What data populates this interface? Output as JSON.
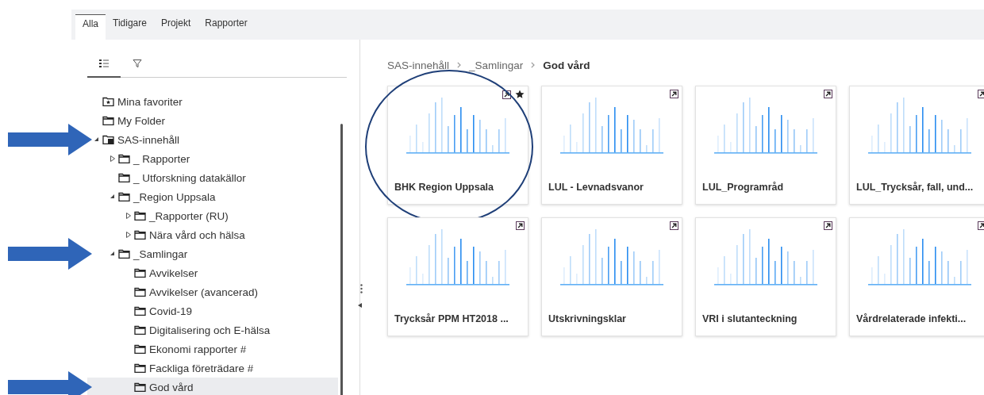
{
  "tabs": [
    {
      "label": "Alla",
      "selected": true
    },
    {
      "label": "Tidigare",
      "selected": false
    },
    {
      "label": "Projekt",
      "selected": false
    },
    {
      "label": "Rapporter",
      "selected": false
    }
  ],
  "view_tabs": [
    {
      "kind": "list",
      "selected": true
    },
    {
      "kind": "filter",
      "selected": false
    }
  ],
  "tree": [
    {
      "label": "Mina favoriter",
      "kind": "favorites",
      "selected": false,
      "arrow": false
    },
    {
      "label": "My Folder",
      "kind": "folder",
      "selected": false,
      "arrow": false
    },
    {
      "label": "SAS-innehåll",
      "kind": "root",
      "selected": false,
      "arrow": true,
      "expanded": true,
      "children": [
        {
          "label": "_ Rapporter",
          "kind": "folder",
          "selected": false,
          "arrow": false,
          "expanded": false
        },
        {
          "label": "_ Utforskning datakällor",
          "kind": "folder",
          "selected": false,
          "arrow": false
        },
        {
          "label": "_Region Uppsala",
          "kind": "folder",
          "selected": false,
          "arrow": false,
          "expanded": true,
          "children": [
            {
              "label": "_Rapporter (RU)",
              "kind": "folder",
              "selected": false,
              "arrow": false,
              "expanded": false
            },
            {
              "label": "Nära vård och hälsa",
              "kind": "folder",
              "selected": false,
              "arrow": false,
              "expanded": false
            }
          ]
        },
        {
          "label": "_Samlingar",
          "kind": "folder",
          "selected": false,
          "arrow": true,
          "expanded": true,
          "children": [
            {
              "label": "Avvikelser",
              "kind": "folder",
              "selected": false,
              "arrow": false
            },
            {
              "label": "Avvikelser (avancerad)",
              "kind": "folder",
              "selected": false,
              "arrow": false
            },
            {
              "label": "Covid-19",
              "kind": "folder",
              "selected": false,
              "arrow": false
            },
            {
              "label": "Digitalisering och E-hälsa",
              "kind": "folder",
              "selected": false,
              "arrow": false
            },
            {
              "label": "Ekonomi rapporter #",
              "kind": "folder",
              "selected": false,
              "arrow": false
            },
            {
              "label": "Fackliga företrädare #",
              "kind": "folder",
              "selected": false,
              "arrow": false
            },
            {
              "label": "God vård",
              "kind": "folder",
              "selected": true,
              "arrow": true
            }
          ]
        }
      ]
    }
  ],
  "breadcrumb": [
    "SAS-innehåll",
    "_Samlingar",
    "God vård"
  ],
  "cards": [
    {
      "title": "BHK Region Uppsala",
      "favorite": true,
      "circled": true
    },
    {
      "title": "LUL - Levnadsvanor",
      "favorite": false,
      "circled": false
    },
    {
      "title": "LUL_Programråd",
      "favorite": false,
      "circled": false
    },
    {
      "title": "LUL_Trycksår, fall, und...",
      "favorite": false,
      "circled": false
    },
    {
      "title": "Trycksår PPM HT2018 ...",
      "favorite": false,
      "circled": false
    },
    {
      "title": "Utskrivningsklar",
      "favorite": false,
      "circled": false
    },
    {
      "title": "VRI i slutanteckning",
      "favorite": false,
      "circled": false
    },
    {
      "title": "Vårdrelaterade infekti...",
      "favorite": false,
      "circled": false
    }
  ]
}
